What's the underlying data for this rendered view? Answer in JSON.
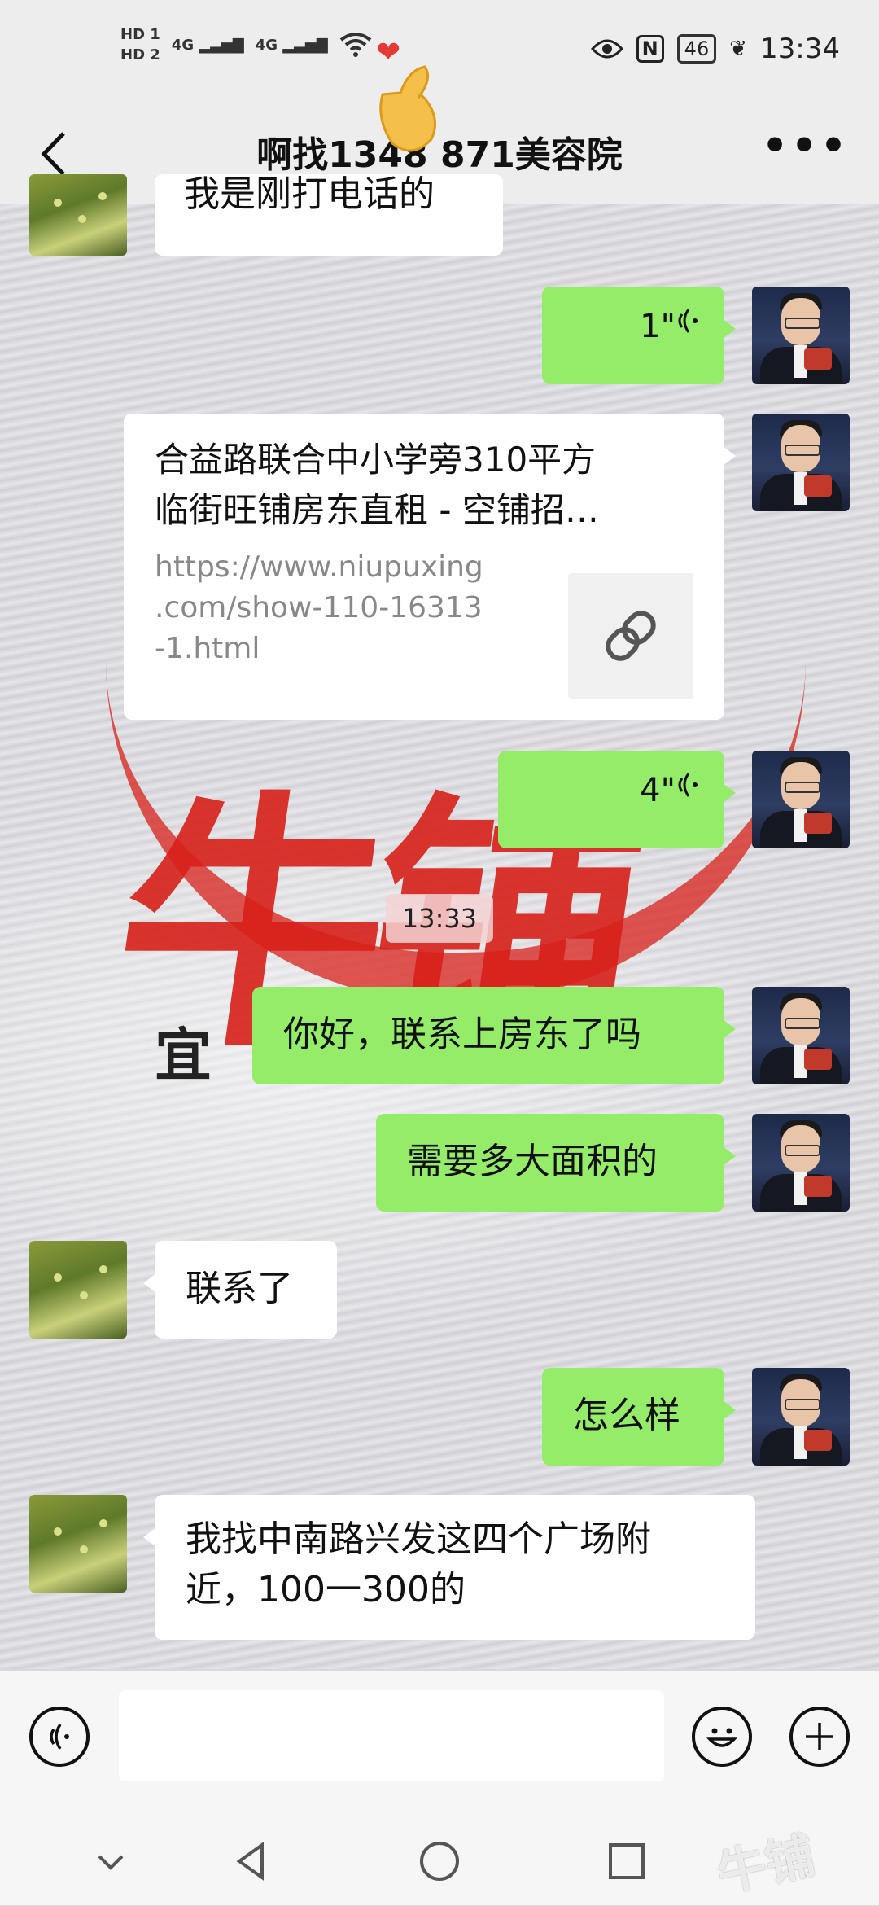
{
  "status_bar": {
    "left_icons": [
      "HD 1",
      "HD 2",
      "4G",
      "4G",
      "wifi-icon"
    ],
    "right_icons": [
      "eye-icon",
      "nfc-icon"
    ],
    "battery": "46",
    "time": "13:34"
  },
  "header": {
    "title": "啊找1348   871美容院",
    "back_icon": "chevron-left-icon",
    "more_label": "•••"
  },
  "messages": [
    {
      "from": "them",
      "type": "text",
      "text": "我是刚打电话的"
    },
    {
      "from": "me",
      "type": "voice",
      "duration": "1\""
    },
    {
      "from": "me",
      "type": "link",
      "title_line1": "合益路联合中小学旁310平方",
      "title_line2": "临街旺铺房东直租 - 空铺招…",
      "url_line1": "https://www.niupuxing",
      "url_line2": ".com/show-110-16313",
      "url_line3": "-1.html"
    },
    {
      "from": "me",
      "type": "voice",
      "duration": "4\""
    },
    {
      "from": "me",
      "type": "text",
      "text": "你好，联系上房东了吗"
    },
    {
      "from": "me",
      "type": "text",
      "text": "需要多大面积的"
    },
    {
      "from": "them",
      "type": "text",
      "text": "联系了"
    },
    {
      "from": "me",
      "type": "text",
      "text": "怎么样"
    },
    {
      "from": "them",
      "type": "text",
      "text": "我找中南路兴发这四个广场附",
      "text_line2": "近，100一300的"
    }
  ],
  "timestamp": "13:33",
  "colors": {
    "my_bubble": "#95ec69",
    "their_bubble": "#ffffff",
    "bar_bg": "#ededed"
  },
  "input_bar": {
    "voice_icon": "voice-mode-icon",
    "emoji_icon": "emoji-icon",
    "plus_icon": "plus-icon"
  },
  "nav_bar": [
    "chevron-down-icon",
    "back-triangle-icon",
    "home-circle-icon",
    "recents-square-icon"
  ]
}
